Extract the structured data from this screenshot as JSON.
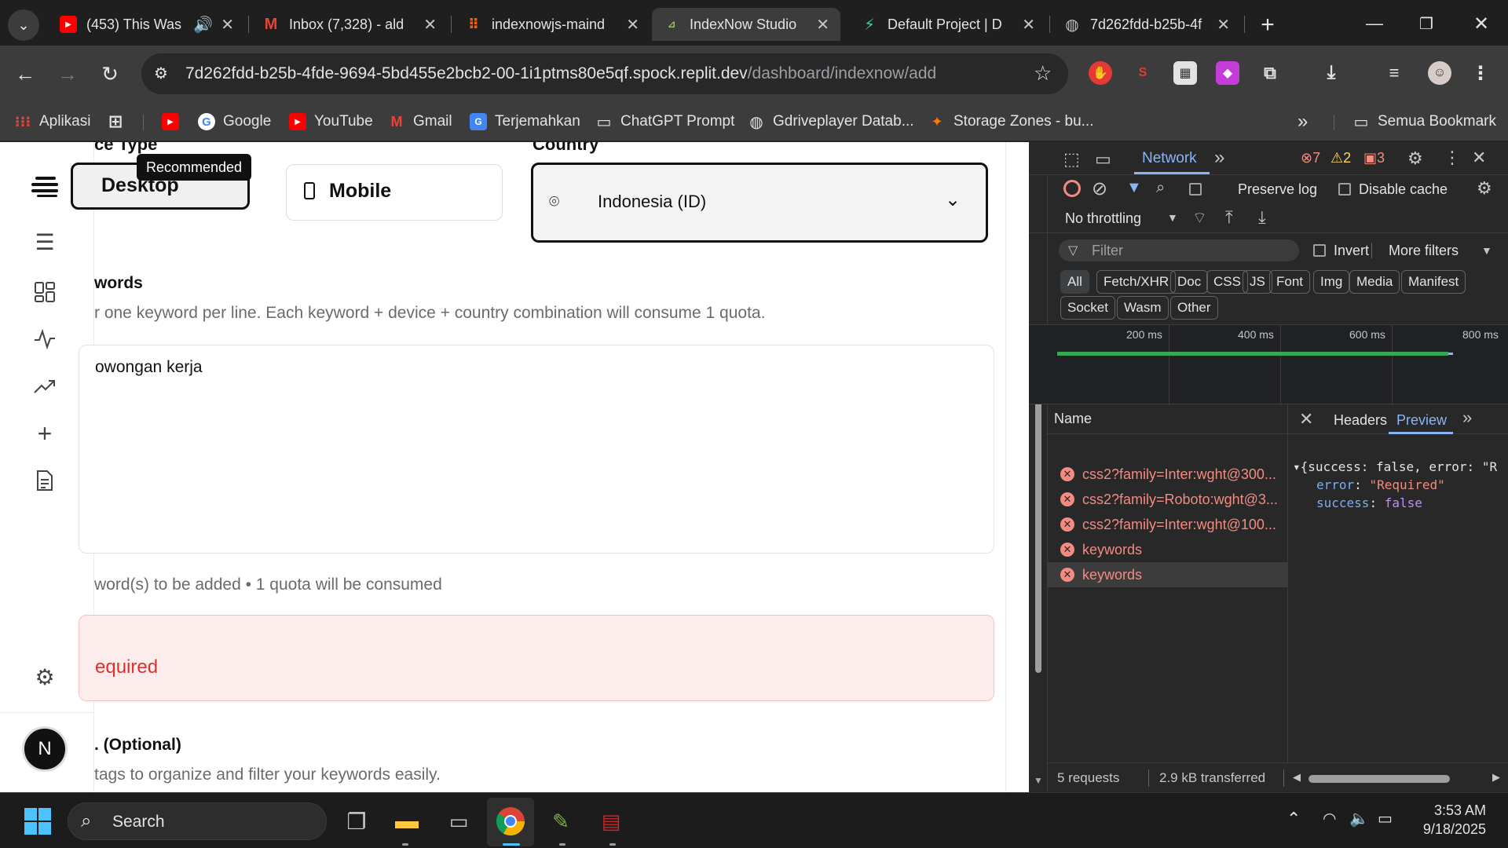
{
  "tabs": [
    {
      "title": "(453) This Was",
      "icon": "youtube-icon",
      "close": "✕",
      "audio": "🔊"
    },
    {
      "title": "Inbox (7,328) - ald",
      "icon": "gmail-icon",
      "close": "✕"
    },
    {
      "title": "indexnowjs-maind",
      "icon": "replit-icon",
      "close": "✕"
    },
    {
      "title": "IndexNow Studio",
      "icon": "indexnow-icon",
      "close": "✕",
      "active": true
    },
    {
      "title": "Default Project | D",
      "icon": "supabase-icon",
      "close": "✕"
    },
    {
      "title": "7d262fdd-b25b-4f",
      "icon": "globe-icon",
      "close": "✕"
    }
  ],
  "toolbar": {
    "url_host": "7d262fdd-b25b-4fde-9694-5bd455e2bcb2-00-1i1ptms80e5qf.spock.replit.dev",
    "url_path": "/dashboard/indexnow/add"
  },
  "bookmarks": [
    {
      "label": "Aplikasi",
      "icon": "apps-grid-icon"
    },
    {
      "label": "",
      "icon": "grid-icon"
    },
    {
      "label": "",
      "icon": "youtube-icon"
    },
    {
      "label": "Google",
      "icon": "google-icon"
    },
    {
      "label": "YouTube",
      "icon": "youtube-icon"
    },
    {
      "label": "Gmail",
      "icon": "gmail-icon"
    },
    {
      "label": "Terjemahkan",
      "icon": "translate-icon"
    },
    {
      "label": "ChatGPT Prompt",
      "icon": "folder-icon"
    },
    {
      "label": "Gdriveplayer Datab...",
      "icon": "globe-icon"
    },
    {
      "label": "Storage Zones - bu...",
      "icon": "bunny-icon"
    }
  ],
  "bookmarks_overflow": "»",
  "bookmarks_all": "Semua Bookmark",
  "page": {
    "device_label_partial": "ce Type",
    "country_label_partial": "Country",
    "recommended_badge": "Recommended",
    "device_desktop": "Desktop",
    "device_mobile": "Mobile",
    "country_value": "Indonesia (ID)",
    "keywords_label_partial": "words",
    "keywords_help_partial": "r one keyword per line. Each keyword + device + country combination will consume 1 quota.",
    "keywords_value_partial": "owongan kerja",
    "summary_partial": "word(s) to be added • 1 quota will be consumed",
    "error_title_partial": "",
    "error_message_partial": "equired",
    "tags_label_partial": ". (Optional)",
    "tags_help_partial": "tags to organize and filter your keywords easily.",
    "avatar_letter": "N"
  },
  "devtools": {
    "panel_tab": "Network",
    "errors_count": "7",
    "warnings_count": "2",
    "issues_count": "3",
    "preserve_log": "Preserve log",
    "disable_cache": "Disable cache",
    "throttling": "No throttling",
    "filter_placeholder": "Filter",
    "invert": "Invert",
    "more_filters": "More filters",
    "type_filters": [
      "All",
      "Fetch/XHR",
      "Doc",
      "CSS",
      "JS",
      "Font",
      "Img",
      "Media",
      "Manifest",
      "Socket",
      "Wasm",
      "Other"
    ],
    "timeline_ticks": [
      "200 ms",
      "400 ms",
      "600 ms",
      "800 ms"
    ],
    "name_header": "Name",
    "requests": [
      {
        "name": "css2?family=Inter:wght@300..."
      },
      {
        "name": "css2?family=Roboto:wght@3..."
      },
      {
        "name": "css2?family=Inter:wght@100..."
      },
      {
        "name": "keywords"
      },
      {
        "name": "keywords",
        "selected": true
      }
    ],
    "detail_tabs": [
      "Headers",
      "Preview"
    ],
    "preview_summary": "▾{success: false, error: \"R",
    "preview_error_key": "error",
    "preview_error_value": "\"Required\"",
    "preview_success_key": "success",
    "preview_success_value": "false",
    "status_requests": "5 requests",
    "status_transferred": "2.9 kB transferred"
  },
  "taskbar": {
    "search_label": "Search",
    "time": "3:53 AM",
    "date": "9/18/2025"
  },
  "colors": {
    "accent_blue": "#8ab4f8",
    "error_red": "#f28b82",
    "warning_yellow": "#fdd663",
    "timeline_green": "#34a853",
    "error_bg": "#fdecec",
    "error_text": "#d93232"
  }
}
